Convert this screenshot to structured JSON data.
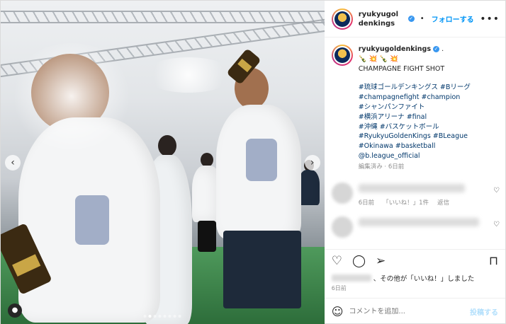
{
  "header": {
    "username": "ryukyugoldenkings",
    "follow_label": "フォローする",
    "separator": "•",
    "verified_mark": "✓",
    "more_label": "•••"
  },
  "caption": {
    "username": "ryukyugoldenkings",
    "suffix": ".",
    "emoji_line": "🍾 💥 🍾 💥",
    "title": "CHAMPAGNE FIGHT SHOT",
    "hashtags": [
      "#琉球ゴールデンキングス #Bリーグ",
      "#champagnefight #champion",
      "#シャンパンファイト",
      "#横浜アリーナ #final",
      "#沖縄 #バスケットボール",
      "#RyukyuGoldenKings #BLeague",
      "#Okinawa #basketball",
      "@b.league_official"
    ],
    "meta": "編集済み · 6日前"
  },
  "replies": [
    {
      "time": "6日前",
      "likes": "「いいね！」1件",
      "reply_label": "返信"
    }
  ],
  "likes_suffix": "、その他が「いいね！」しました",
  "post_date": "6日前",
  "comment_placeholder": "コメントを追加...",
  "post_label": "投稿する",
  "icons": {
    "heart": "♡",
    "comment": "◯",
    "share": "➢",
    "save": "⊓",
    "emoji": "☺",
    "prev": "‹",
    "next": "›",
    "tag_user": "●"
  },
  "colors": {
    "link": "#00376b",
    "accent": "#0095f6",
    "verified": "#3897f0"
  }
}
